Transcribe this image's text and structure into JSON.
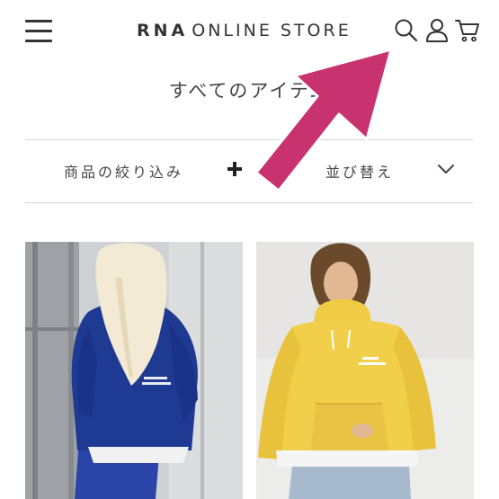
{
  "header": {
    "brand": "RNA",
    "store_label": "ONLINE STORE",
    "icons": [
      "menu-icon",
      "search-icon",
      "user-icon",
      "cart-icon"
    ]
  },
  "page": {
    "title": "すべてのアイテム"
  },
  "filter_bar": {
    "filter_label": "商品の絞り込み",
    "filter_icon": "plus-icon",
    "sort_label": "並び替え",
    "sort_icon": "chevron-down-icon"
  },
  "products": [
    {
      "color": "#1f3a93",
      "description_icon": "navy-hoodie"
    },
    {
      "color": "#f2cf4a",
      "description_icon": "yellow-half-zip-sweatshirt"
    }
  ],
  "annotation": {
    "arrow_color": "#c8336f",
    "points_to": "search-icon"
  }
}
